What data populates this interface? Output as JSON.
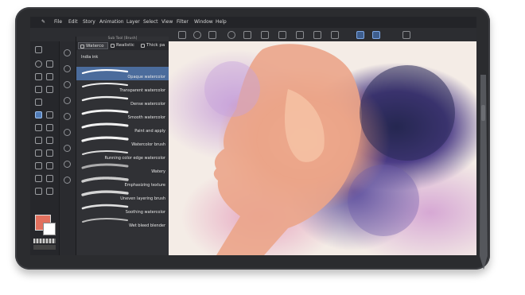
{
  "menu": [
    "File",
    "Edit",
    "Story",
    "Animation",
    "Layer",
    "Select",
    "View",
    "Filter",
    "Window",
    "Help"
  ],
  "panel": {
    "title": "Sub Tool [Brush]",
    "tabs": [
      "Waterco",
      "Realistic",
      "Thick pa"
    ],
    "brushes": [
      "India ink",
      "Opaque watercolor",
      "Transparent watercolor",
      "Dense watercolor",
      "Smooth watercolor",
      "Paint and apply",
      "Watercolor brush",
      "Running color edge watercolor",
      "Watery",
      "Emphasizing texture",
      "Uneven layering brush",
      "Soothing watercolor",
      "Wet bleed blender"
    ],
    "selected_brush": "Opaque watercolor"
  },
  "colors": {
    "main": "#e2705e",
    "sub": "#ffffff",
    "accent": "#4b6c9c"
  }
}
